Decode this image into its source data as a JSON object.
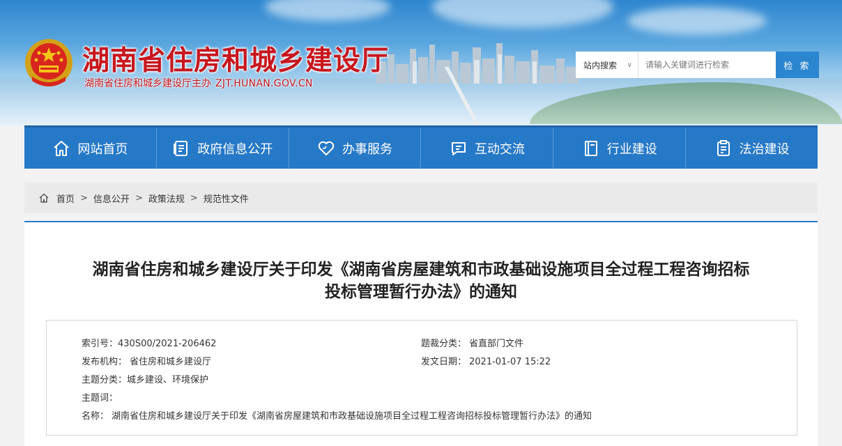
{
  "header": {
    "title": "湖南省住房和城乡建设厅",
    "subtitle": "湖南省住房和城乡建设厅主办",
    "url": "ZJT.HUNAN.GOV.CN"
  },
  "search": {
    "scope": "站内搜索",
    "placeholder": "请输入关键词进行检索",
    "button": "检 索"
  },
  "nav": [
    {
      "label": "网站首页",
      "icon": "home-icon"
    },
    {
      "label": "政府信息公开",
      "icon": "document-icon"
    },
    {
      "label": "办事服务",
      "icon": "heart-icon"
    },
    {
      "label": "互动交流",
      "icon": "chat-icon"
    },
    {
      "label": "行业建设",
      "icon": "book-icon"
    },
    {
      "label": "法治建设",
      "icon": "clipboard-icon"
    }
  ],
  "breadcrumb": [
    "首页",
    "信息公开",
    "政策法规",
    "规范性文件"
  ],
  "article": {
    "title_line1": "湖南省住房和城乡建设厅关于印发《湖南省房屋建筑和市政基础设施项目全过程工程咨询招标",
    "title_line2": "投标管理暂行办法》的通知",
    "meta": {
      "index_label": "索引号：",
      "index_value": "430S00/2021-206462",
      "category_label": "题裁分类：",
      "category_value": "省直部门文件",
      "publisher_label": "发布机构：",
      "publisher_value": "省住房和城乡建设厅",
      "date_label": "发文日期：",
      "date_value": "2021-01-07 15:22",
      "topic_label": "主题分类：",
      "topic_value": "城乡建设、环境保护",
      "keywords_label": "主题词：",
      "keywords_value": "",
      "name_label": "名称：",
      "name_value": "湖南省住房和城乡建设厅关于印发《湖南省房屋建筑和市政基础设施项目全过程工程咨询招标投标管理暂行办法》的通知"
    }
  },
  "colors": {
    "brand_red": "#c8161d",
    "nav_blue": "#2679c7",
    "search_blue": "#2b86cf"
  }
}
